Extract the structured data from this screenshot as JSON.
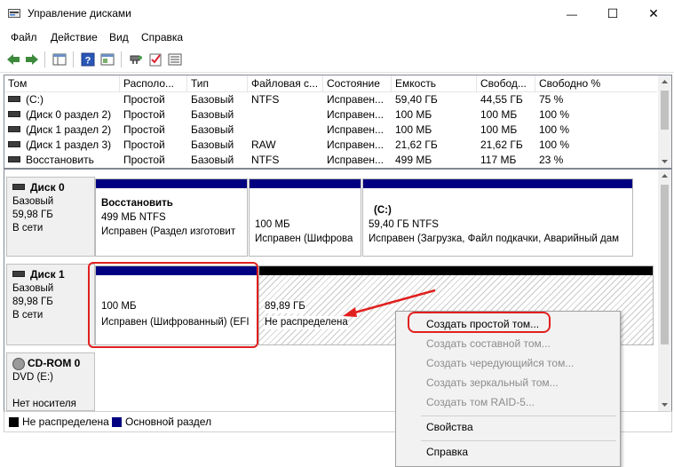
{
  "window": {
    "title": "Управление дисками",
    "minimize_glyph": "—",
    "maximize_glyph": "☐",
    "close_glyph": "✕"
  },
  "menu": [
    "Файл",
    "Действие",
    "Вид",
    "Справка"
  ],
  "toolbar": [
    "back-icon",
    "forward-icon",
    "panel-icon",
    "help-icon",
    "panel2-icon",
    "connect-icon",
    "check-icon",
    "list-icon"
  ],
  "volume_table": {
    "columns": [
      "Том",
      "Располо...",
      "Тип",
      "Файловая с...",
      "Состояние",
      "Емкость",
      "Свобод...",
      "Свободно %"
    ],
    "rows": [
      [
        "(C:)",
        "Простой",
        "Базовый",
        "NTFS",
        "Исправен...",
        "59,40 ГБ",
        "44,55 ГБ",
        "75 %"
      ],
      [
        "(Диск 0 раздел 2)",
        "Простой",
        "Базовый",
        "",
        "Исправен...",
        "100 МБ",
        "100 МБ",
        "100 %"
      ],
      [
        "(Диск 1 раздел 2)",
        "Простой",
        "Базовый",
        "",
        "Исправен...",
        "100 МБ",
        "100 МБ",
        "100 %"
      ],
      [
        "(Диск 1 раздел 3)",
        "Простой",
        "Базовый",
        "RAW",
        "Исправен...",
        "21,62 ГБ",
        "21,62 ГБ",
        "100 %"
      ],
      [
        "Восстановить",
        "Простой",
        "Базовый",
        "NTFS",
        "Исправен...",
        "499 МБ",
        "117 МБ",
        "23 %"
      ]
    ]
  },
  "disks": {
    "disk0": {
      "name": "Диск 0",
      "type": "Базовый",
      "size": "59,98 ГБ",
      "status": "В сети",
      "partitions": [
        {
          "title": "Восстановить",
          "line1": "499 МБ NTFS",
          "line2": "Исправен (Раздел изготовит"
        },
        {
          "title": "",
          "line1": "100 МБ",
          "line2": "Исправен (Шифрова"
        },
        {
          "title": "(C:)",
          "line1": "59,40 ГБ NTFS",
          "line2": "Исправен (Загрузка, Файл подкачки, Аварийный дам"
        }
      ]
    },
    "disk1": {
      "name": "Диск 1",
      "type": "Базовый",
      "size": "89,98 ГБ",
      "status": "В сети",
      "partitions": [
        {
          "line1": "100 МБ",
          "line2": "Исправен (Шифрованный) (EFI"
        },
        {
          "line1": "89,89 ГБ",
          "line2": "Не распределена"
        }
      ]
    },
    "cdrom": {
      "name": "CD-ROM 0",
      "drive": "DVD (E:)",
      "status": "Нет носителя"
    }
  },
  "legend": [
    {
      "label": "Не распределена",
      "color": "#000000"
    },
    {
      "label": "Основной раздел",
      "color": "#000080"
    }
  ],
  "context_menu": {
    "items": [
      {
        "label": "Создать простой том...",
        "enabled": true
      },
      {
        "label": "Создать составной том...",
        "enabled": false
      },
      {
        "label": "Создать чередующийся том...",
        "enabled": false
      },
      {
        "label": "Создать зеркальный том...",
        "enabled": false
      },
      {
        "label": "Создать том RAID-5...",
        "enabled": false
      },
      {
        "label": "Свойства",
        "enabled": true
      },
      {
        "label": "Справка",
        "enabled": true
      }
    ]
  },
  "colors": {
    "primary_partition": "#000080",
    "unallocated": "#000000",
    "annotation": "#e0201e"
  }
}
